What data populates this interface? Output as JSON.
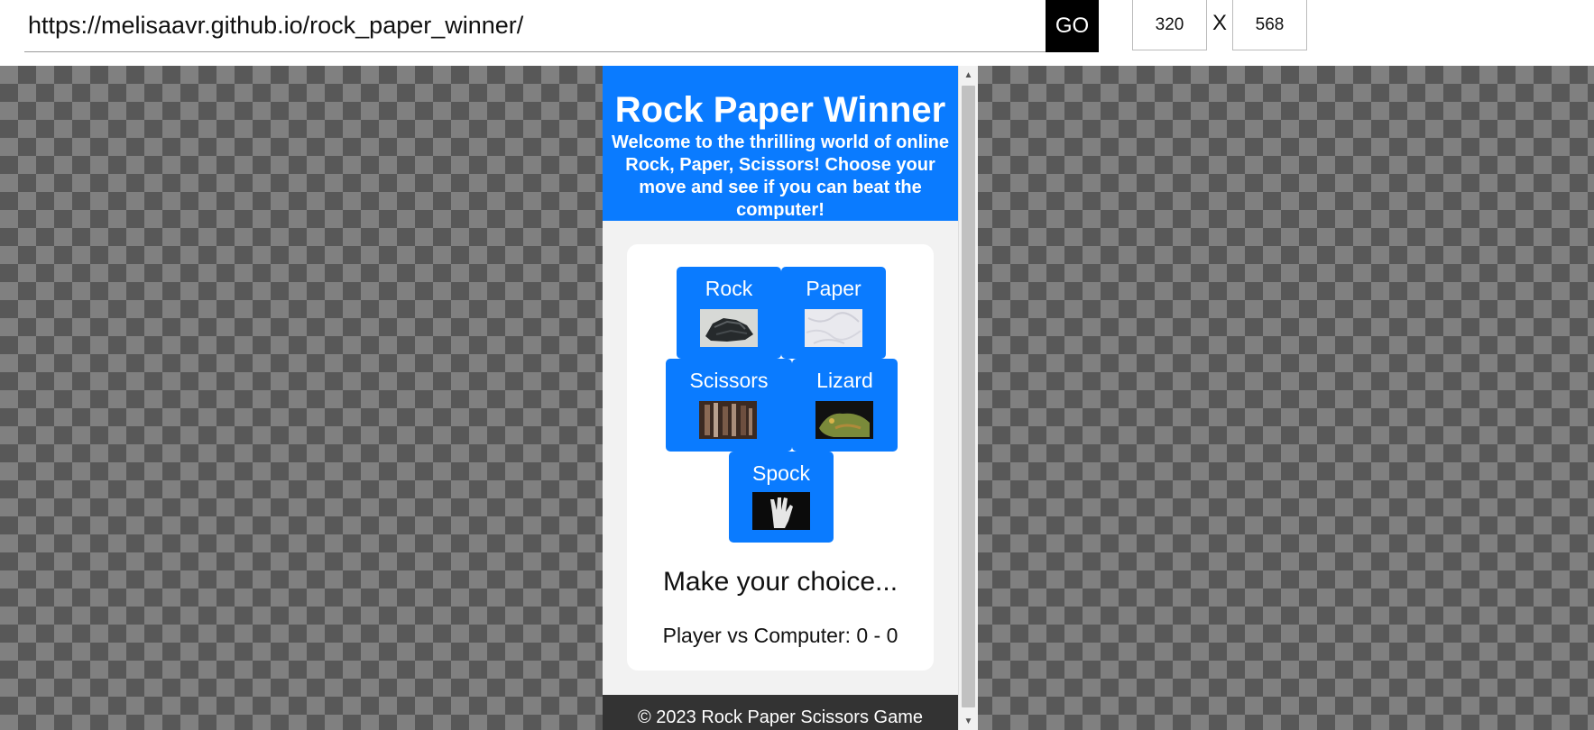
{
  "toolbar": {
    "url": "https://melisaavr.github.io/rock_paper_winner/",
    "go_label": "GO",
    "width": "320",
    "separator": "X",
    "height": "568"
  },
  "site": {
    "title": "Rock Paper Winner",
    "intro": "Welcome to the thrilling world of online Rock, Paper, Scissors! Choose your move and see if you can beat the computer!",
    "choices": [
      {
        "label": "Rock"
      },
      {
        "label": "Paper"
      },
      {
        "label": "Scissors"
      },
      {
        "label": "Lizard"
      },
      {
        "label": "Spock"
      }
    ],
    "status": "Make your choice...",
    "score": "Player vs Computer: 0 - 0",
    "footer": "© 2023 Rock Paper Scissors Game"
  },
  "colors": {
    "header_blue": "#0a7bff",
    "footer_dark": "#333333",
    "checker_dark": "#585858",
    "checker_light": "#808080"
  }
}
